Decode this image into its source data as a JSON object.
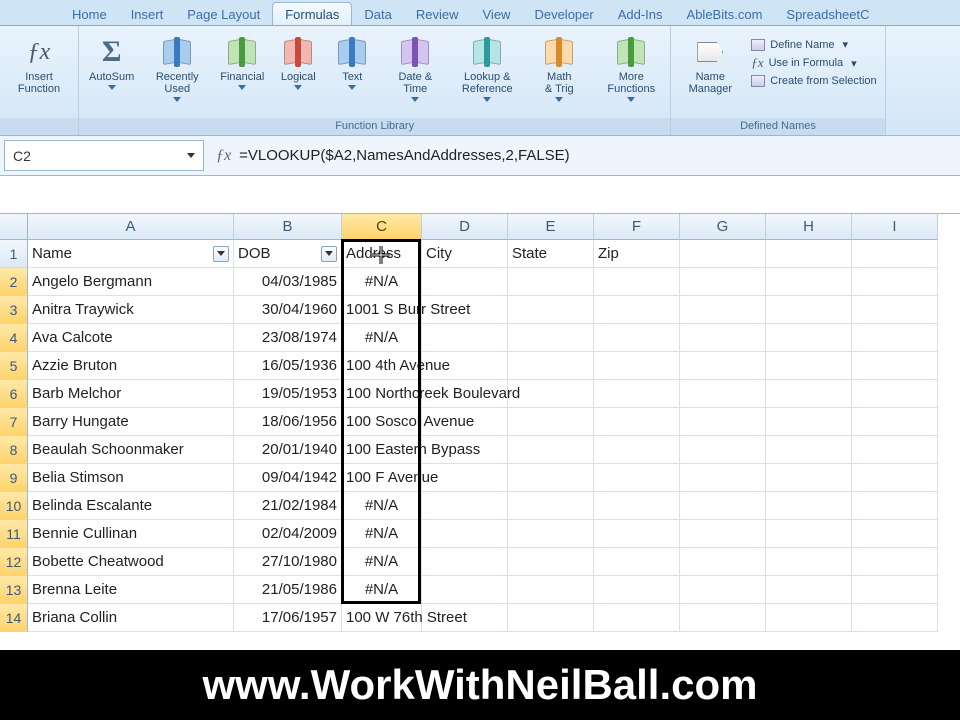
{
  "tabs": {
    "items": [
      "Home",
      "Insert",
      "Page Layout",
      "Formulas",
      "Data",
      "Review",
      "View",
      "Developer",
      "Add-Ins",
      "AbleBits.com",
      "SpreadsheetC"
    ],
    "active_index": 3
  },
  "ribbon": {
    "insert_function": "Insert\nFunction",
    "library_label": "Function Library",
    "defined_label": "Defined Names",
    "autosum": "AutoSum",
    "recent": "Recently\nUsed",
    "financial": "Financial",
    "logical": "Logical",
    "text": "Text",
    "datetime": "Date &\nTime",
    "lookup": "Lookup &\nReference",
    "math": "Math\n& Trig",
    "more": "More\nFunctions",
    "name_mgr": "Name\nManager",
    "define_name": "Define Name",
    "use_in_formula": "Use in Formula",
    "create_selection": "Create from Selection"
  },
  "formula_bar": {
    "cell_ref": "C2",
    "formula": "=VLOOKUP($A2,NamesAndAddresses,2,FALSE)"
  },
  "columns": [
    "A",
    "B",
    "C",
    "D",
    "E",
    "F",
    "G",
    "H",
    "I"
  ],
  "selected_col_index": 2,
  "headers": {
    "A": "Name",
    "B": "DOB",
    "C": "Address",
    "D": "City",
    "E": "State",
    "F": "Zip"
  },
  "rows": [
    {
      "n": 2,
      "name": "Angelo Bergmann",
      "dob": "04/03/1985",
      "addr": "#N/A"
    },
    {
      "n": 3,
      "name": "Anitra Traywick",
      "dob": "30/04/1960",
      "addr": "1001 S Burr Street"
    },
    {
      "n": 4,
      "name": "Ava Calcote",
      "dob": "23/08/1974",
      "addr": "#N/A"
    },
    {
      "n": 5,
      "name": "Azzie Bruton",
      "dob": "16/05/1936",
      "addr": "100 4th Avenue"
    },
    {
      "n": 6,
      "name": "Barb Melchor",
      "dob": "19/05/1953",
      "addr": "100 Northcreek Boulevard"
    },
    {
      "n": 7,
      "name": "Barry Hungate",
      "dob": "18/06/1956",
      "addr": "100 Soscol Avenue"
    },
    {
      "n": 8,
      "name": "Beaulah Schoonmaker",
      "dob": "20/01/1940",
      "addr": "100 Eastern Bypass"
    },
    {
      "n": 9,
      "name": "Belia Stimson",
      "dob": "09/04/1942",
      "addr": "100 F Avenue"
    },
    {
      "n": 10,
      "name": "Belinda Escalante",
      "dob": "21/02/1984",
      "addr": "#N/A"
    },
    {
      "n": 11,
      "name": "Bennie Cullinan",
      "dob": "02/04/2009",
      "addr": "#N/A"
    },
    {
      "n": 12,
      "name": "Bobette Cheatwood",
      "dob": "27/10/1980",
      "addr": "#N/A"
    },
    {
      "n": 13,
      "name": "Brenna Leite",
      "dob": "21/05/1986",
      "addr": "#N/A"
    },
    {
      "n": 14,
      "name": "Briana Collin",
      "dob": "17/06/1957",
      "addr": "100 W 76th Street"
    }
  ],
  "banner": "www.WorkWithNeilBall.com"
}
